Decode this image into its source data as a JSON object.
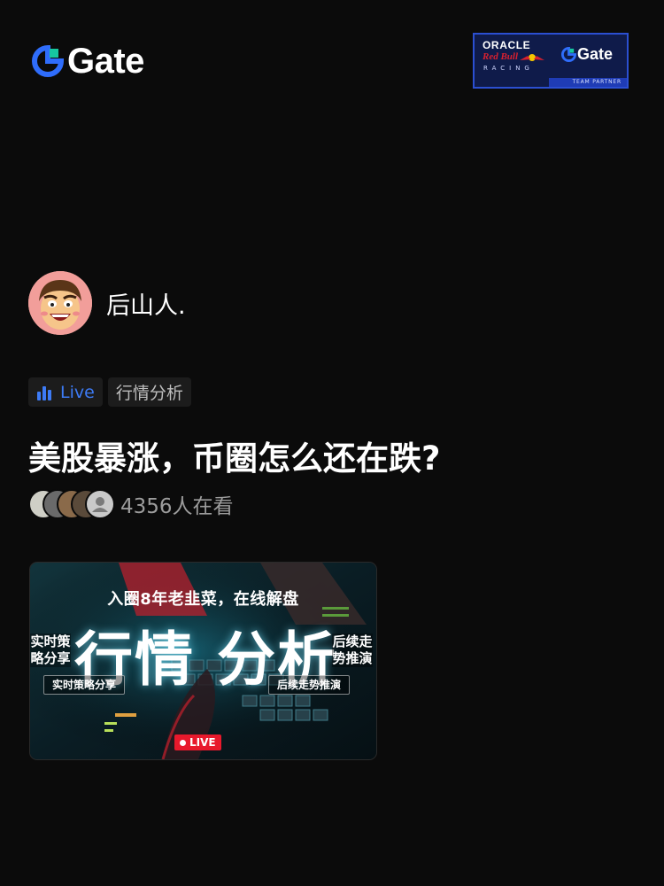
{
  "brand": {
    "name": "Gate",
    "logo_icon": "gate-logo-icon"
  },
  "partner": {
    "line1": "ORACLE",
    "line2": "Red Bull",
    "line3": "RACING",
    "brand": "Gate",
    "footer": "TEAM PARTNER"
  },
  "host": {
    "name": "后山人."
  },
  "tags": {
    "live": "Live",
    "topic": "行情分析"
  },
  "stream": {
    "title": "美股暴涨，币圈怎么还在跌?",
    "viewers": "4356人在看"
  },
  "cover": {
    "headline": "入圈8年老韭菜，在线解盘",
    "big": "行情 分析",
    "left_side": "实时策略分享",
    "right_side": "后续走势推演",
    "left_pill": "实时策略分享",
    "right_pill": "后续走势推演",
    "live": "LIVE"
  },
  "colors": {
    "background": "#0b0b0b",
    "accent_blue": "#3d7bf5",
    "live_red": "#e8192c"
  }
}
